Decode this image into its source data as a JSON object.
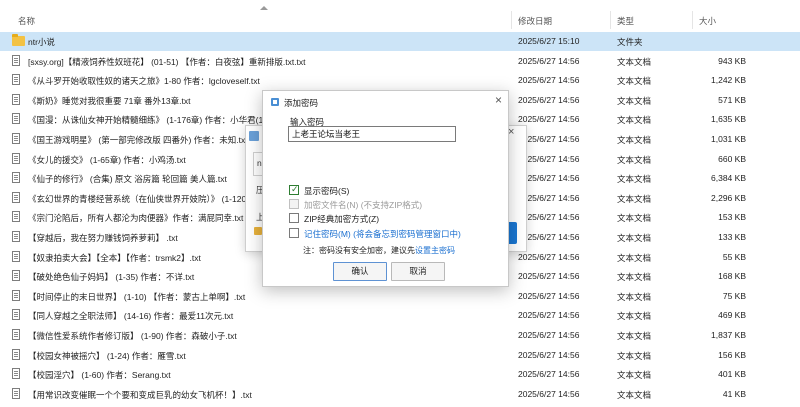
{
  "header": {
    "name": "名称",
    "date": "修改日期",
    "type": "类型",
    "size": "大小"
  },
  "rows": [
    {
      "name": "ntr小说",
      "date": "2025/6/27 15:10",
      "type": "文件夹",
      "size": "",
      "folder": true,
      "selected": true
    },
    {
      "name": "[sxsy.org]【精液饲养性奴班花】 (01-51) 【作者：白夜弦】重新排版.txt.txt",
      "date": "2025/6/27 14:56",
      "type": "文本文档",
      "size": "943 KB"
    },
    {
      "name": "《从斗罗开始收取性奴的诸天之旅》1-80 作者：lgcloveself.txt",
      "date": "2025/6/27 14:56",
      "type": "文本文档",
      "size": "1,242 KB"
    },
    {
      "name": "《斯奶》睡觉对我很重要 71章 番外13章.txt",
      "date": "2025/6/27 14:56",
      "type": "文本文档",
      "size": "571 KB"
    },
    {
      "name": "《国漫：从诛仙女神开始精髓细练》 (1-176章) 作者：小华君(1)",
      "date": "2025/6/27 14:56",
      "type": "文本文档",
      "size": "1,635 KB"
    },
    {
      "name": "《国王游戏明星》 (第一部完修改版 四番外) 作者：未知.txt",
      "date": "2025/6/27 14:56",
      "type": "文本文档",
      "size": "1,031 KB"
    },
    {
      "name": "《女儿的援交》 (1-65章) 作者：小鸡汤.txt",
      "date": "2025/6/27 14:56",
      "type": "文本文档",
      "size": "660 KB"
    },
    {
      "name": "《仙子的修行》 (合集) 原文 浴房篇 轮回篇 美人篇.txt",
      "date": "2025/6/27 14:56",
      "type": "文本文档",
      "size": "6,384 KB"
    },
    {
      "name": "《玄幻世界的青楼经营系统（在仙侠世界开妓院）》 (1-120",
      "date": "2025/6/27 14:56",
      "type": "文本文档",
      "size": "2,296 KB"
    },
    {
      "name": "《宗门沦陷后，所有人都沦为肉便器》作者：满屁同幸.txt",
      "date": "2025/6/27 14:56",
      "type": "文本文档",
      "size": "153 KB"
    },
    {
      "name": "【穿越后，我在努力赚钱饲养萝莉】 .txt",
      "date": "2025/6/27 14:56",
      "type": "文本文档",
      "size": "133 KB"
    },
    {
      "name": "【奴隶拍卖大会】【全本】【作者：trsmk2】.txt",
      "date": "2025/6/27 14:56",
      "type": "文本文档",
      "size": "55 KB"
    },
    {
      "name": "【破处绝色仙子妈妈】 (1-35) 作者：不详.txt",
      "date": "2025/6/27 14:56",
      "type": "文本文档",
      "size": "168 KB"
    },
    {
      "name": "【时间停止的末日世界】 (1-10) 【作者：蒙古上单啊】.txt",
      "date": "2025/6/27 14:56",
      "type": "文本文档",
      "size": "75 KB"
    },
    {
      "name": "【同人穿越之全职法师】 (14-16) 作者：最爱11次元.txt",
      "date": "2025/6/27 14:56",
      "type": "文本文档",
      "size": "469 KB"
    },
    {
      "name": "【微信性爱系统作者修订版】 (1-90) 作者：森破小子.txt",
      "date": "2025/6/27 14:56",
      "type": "文本文档",
      "size": "1,837 KB"
    },
    {
      "name": "【校园女神被摇穴】 (1-24) 作者：雁雪.txt",
      "date": "2025/6/27 14:56",
      "type": "文本文档",
      "size": "156 KB"
    },
    {
      "name": "【校园淫穴】 (1-60) 作者：Serang.txt",
      "date": "2025/6/27 14:56",
      "type": "文本文档",
      "size": "401 KB"
    },
    {
      "name": "【用常识改变催眠一个个要和变成巨乳的幼女飞机杯！】.txt",
      "date": "2025/6/27 14:56",
      "type": "文本文档",
      "size": "41 KB"
    }
  ],
  "bg_dialog": {
    "input_fragment": "n",
    "text1": "压",
    "text2": "上"
  },
  "dialog": {
    "title": "添加密码",
    "close": "×",
    "input_label": "输入密码",
    "password_value": "上老王论坛当老王",
    "show_password": "显示密码(S)",
    "encrypt_filename": "加密文件名(N)",
    "encrypt_filename_note": "(不支持ZIP格式)",
    "zip_classic": "ZIP经典加密方式(Z)",
    "remember_password": "记住密码(M)",
    "remember_note": "(将会备忘到密码管理窗口中)",
    "note_prefix": "注：密码没有安全加密，建议先",
    "note_link": "设置主密码",
    "ok": "确认",
    "cancel": "取消"
  },
  "colors": {
    "selected_row": "#cce4f7",
    "accent": "#1a6fd0",
    "checkbox_on": "#2e7d32"
  }
}
